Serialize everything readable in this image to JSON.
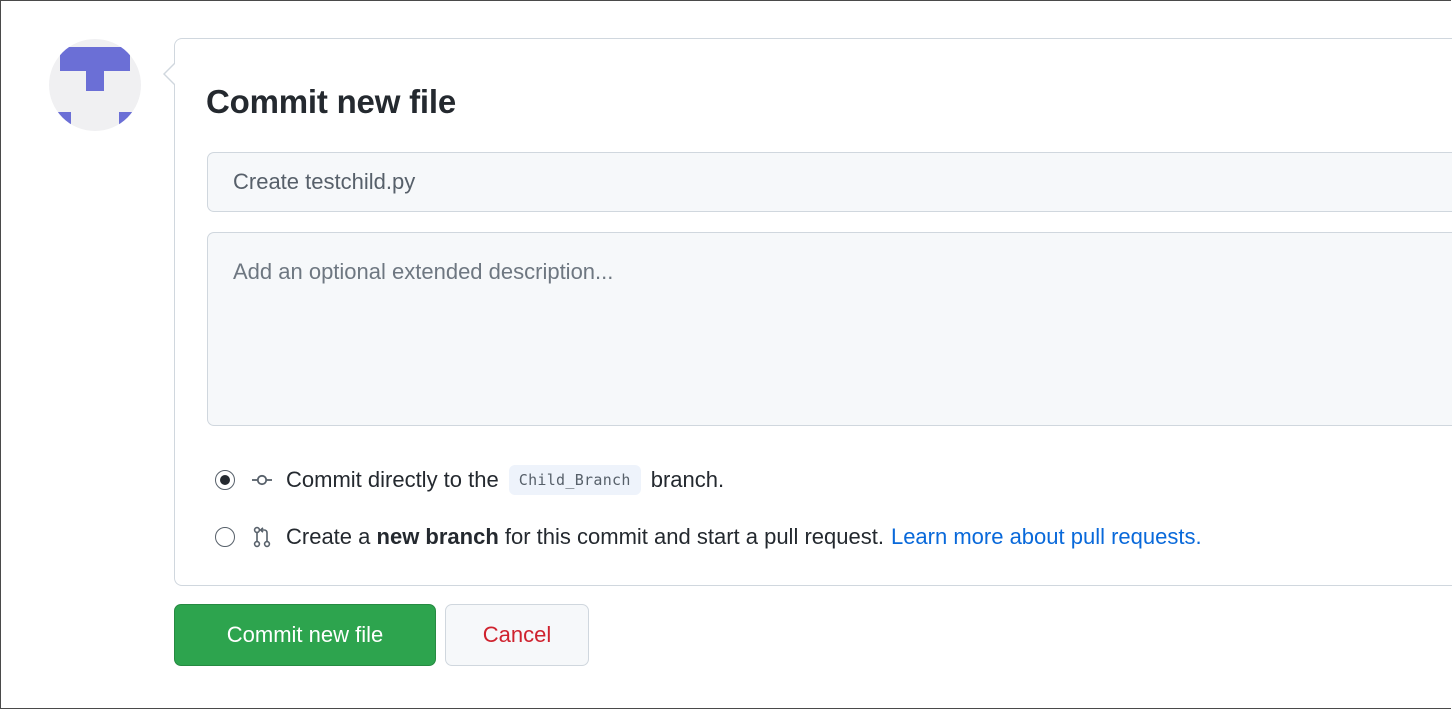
{
  "form": {
    "title": "Commit new file",
    "summary": {
      "placeholder": "Create testchild.py",
      "value": ""
    },
    "description": {
      "placeholder": "Add an optional extended description..."
    },
    "options": [
      {
        "selected": true,
        "icon": "git-commit-icon",
        "text_before": "Commit directly to the",
        "branch": "Child_Branch",
        "text_after": "branch."
      },
      {
        "selected": false,
        "icon": "git-pull-request-icon",
        "text_before": "Create a",
        "bold": "new branch",
        "text_after": "for this commit and start a pull request.",
        "link": "Learn more about pull requests."
      }
    ]
  },
  "buttons": {
    "commit_label": "Commit new file",
    "cancel_label": "Cancel"
  },
  "colors": {
    "primary_button": "#2da44e",
    "cancel_text": "#cf222e",
    "link": "#0969da",
    "avatar": "#6b6fd6"
  }
}
